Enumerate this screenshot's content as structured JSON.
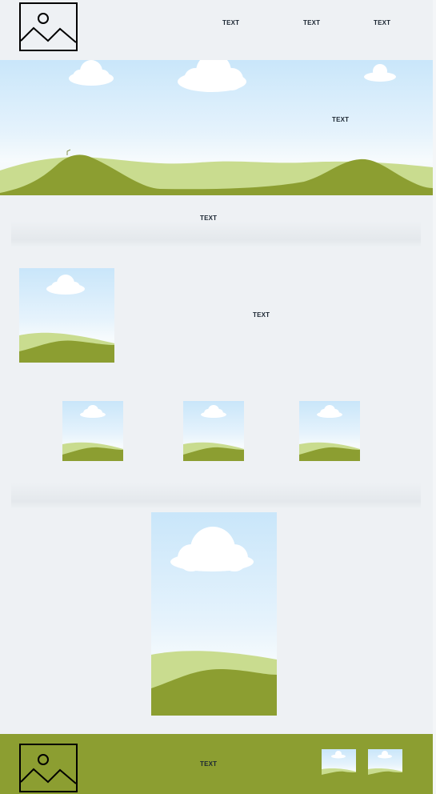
{
  "header": {
    "logo_icon": "image-placeholder-icon",
    "nav": [
      {
        "label": "TEXT"
      },
      {
        "label": "TEXT"
      },
      {
        "label": "TEXT"
      }
    ]
  },
  "hero": {
    "heading": "TEXT",
    "image_icon": "landscape-image"
  },
  "section_band_1": {
    "text": "TEXT"
  },
  "feature": {
    "image_icon": "landscape-image",
    "text": "TEXT"
  },
  "gallery": {
    "items": [
      {
        "image_icon": "landscape-image"
      },
      {
        "image_icon": "landscape-image"
      },
      {
        "image_icon": "landscape-image"
      }
    ]
  },
  "large_image": {
    "image_icon": "landscape-image"
  },
  "footer": {
    "logo_icon": "image-placeholder-icon",
    "text": "TEXT",
    "thumbnails": [
      {
        "image_icon": "landscape-image"
      },
      {
        "image_icon": "landscape-image"
      }
    ]
  },
  "colors": {
    "background": "#eef1f4",
    "grass_dark": "#8c9e31",
    "grass_light": "#c9dc8f",
    "sky_top": "#c9e6fa",
    "text": "#1c2733"
  }
}
